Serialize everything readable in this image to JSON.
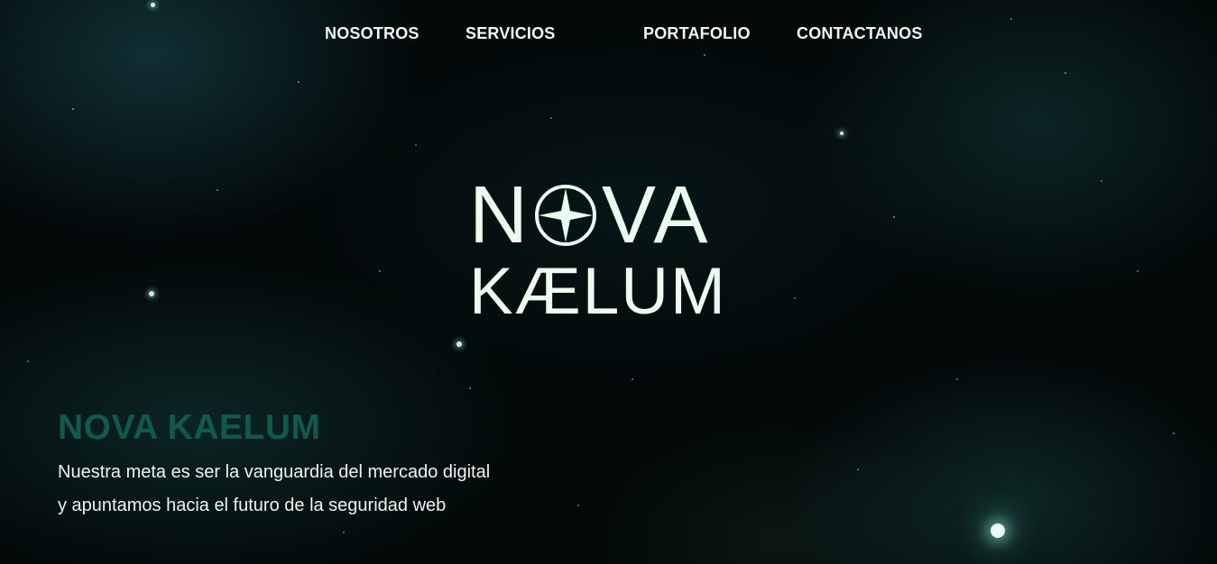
{
  "nav": {
    "items": [
      {
        "label": "NOSOTROS"
      },
      {
        "label": "SERVICIOS"
      },
      {
        "label": "PORTAFOLIO"
      },
      {
        "label": "CONTACTANOS"
      }
    ]
  },
  "logo": {
    "line1_before": "N",
    "line1_after": "VA",
    "line2": "KÆLUM",
    "compass_icon": "compass-star-icon"
  },
  "hero": {
    "headline": "NOVA KAELUM",
    "tagline_lines": [
      "Nuestra meta es ser la vanguardia del mercado digital",
      "y apuntamos hacia el futuro de la seguridad web"
    ]
  },
  "colors": {
    "background": "#030909",
    "nav_text": "#f2f8f2",
    "logo_text": "#ecfbef",
    "headline": "#0e5a4c",
    "tagline": "#eef4f0"
  }
}
